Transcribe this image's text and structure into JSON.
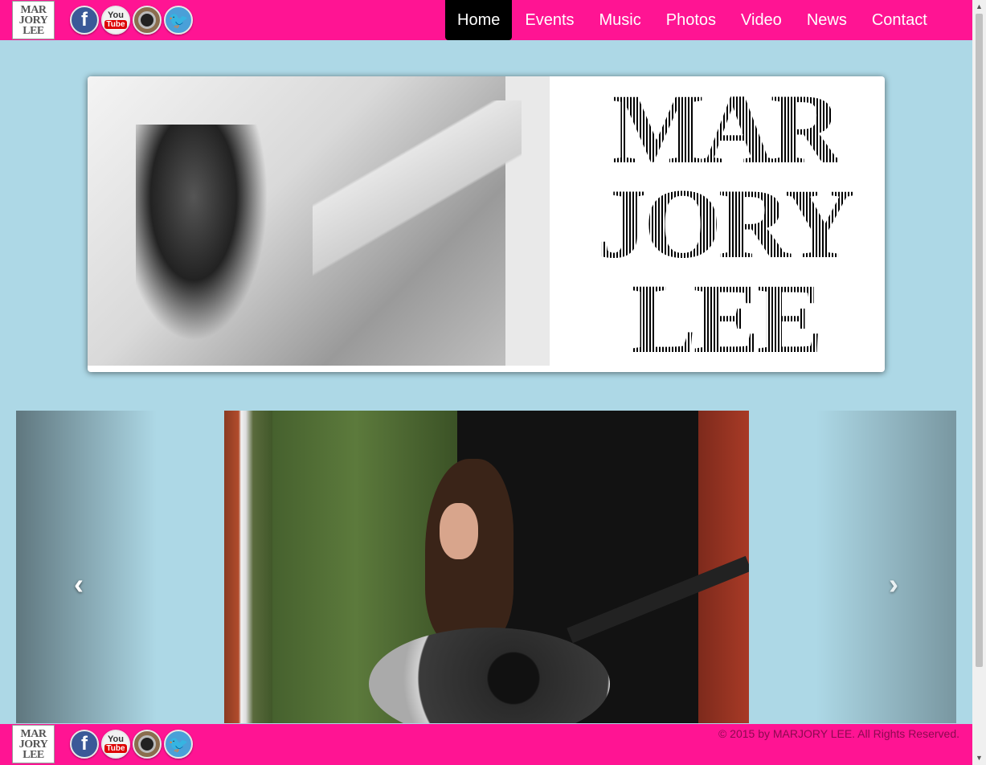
{
  "brand": {
    "logo_lines": [
      "MAR",
      "JORY",
      "LEE"
    ],
    "accent_color": "#ff1493",
    "background_color": "#add8e6"
  },
  "social": [
    {
      "name": "facebook",
      "glyph": "f"
    },
    {
      "name": "youtube",
      "you": "You",
      "tube": "Tube"
    },
    {
      "name": "instagram",
      "glyph": ""
    },
    {
      "name": "twitter",
      "glyph": "🐦"
    }
  ],
  "nav": {
    "items": [
      "Home",
      "Events",
      "Music",
      "Photos",
      "Video",
      "News",
      "Contact"
    ],
    "active": "Home"
  },
  "banner": {
    "title_lines": [
      "MAR",
      "JORY",
      "LEE"
    ]
  },
  "carousel": {
    "prev_glyph": "‹",
    "next_glyph": "›"
  },
  "footer": {
    "copyright": "© 2015 by MARJORY LEE. All Rights Reserved."
  }
}
